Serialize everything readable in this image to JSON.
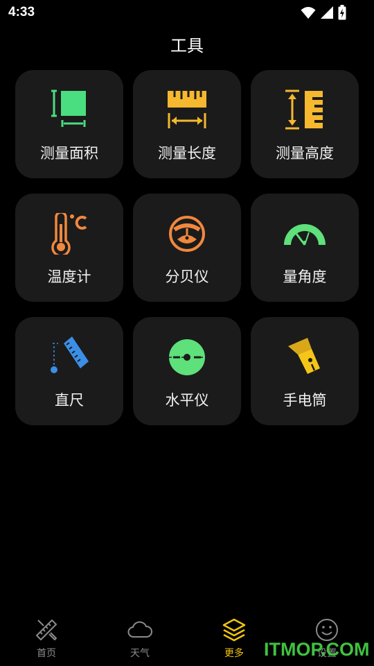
{
  "status_bar": {
    "time": "4:33"
  },
  "header": {
    "title": "工具"
  },
  "tools": [
    {
      "label": "测量面积",
      "icon": "measure-area-icon",
      "color": "#4ade80"
    },
    {
      "label": "测量长度",
      "icon": "ruler-length-icon",
      "color": "#f5b82e"
    },
    {
      "label": "测量高度",
      "icon": "height-measure-icon",
      "color": "#f5b82e"
    },
    {
      "label": "温度计",
      "icon": "thermometer-icon",
      "color": "#f0883e"
    },
    {
      "label": "分贝仪",
      "icon": "decibel-meter-icon",
      "color": "#f0883e"
    },
    {
      "label": "量角度",
      "icon": "protractor-icon",
      "color": "#5ee07a"
    },
    {
      "label": "直尺",
      "icon": "ruler-icon",
      "color": "#3b8fe6"
    },
    {
      "label": "水平仪",
      "icon": "spirit-level-icon",
      "color": "#5ee07a"
    },
    {
      "label": "手电筒",
      "icon": "flashlight-icon",
      "color": "#f5c518"
    }
  ],
  "bottom_nav": [
    {
      "label": "首页",
      "icon": "pencil-ruler-icon"
    },
    {
      "label": "天气",
      "icon": "cloud-icon"
    },
    {
      "label": "更多",
      "icon": "layers-icon",
      "active": true
    },
    {
      "label": "设置",
      "icon": "smiley-icon"
    }
  ],
  "watermark": "ITMOP.COM",
  "colors": {
    "background": "#000000",
    "tile": "#1b1b1b",
    "accent": "#f1c40f",
    "nav_inactive": "#8b8b8b"
  }
}
